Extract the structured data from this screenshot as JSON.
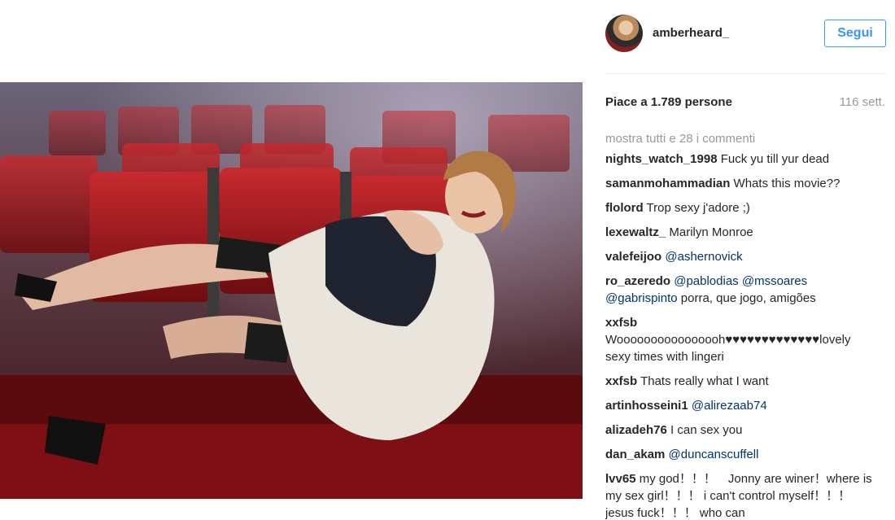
{
  "post": {
    "image_alt": "Foto: donna in lingerie su poltrone rosse di un cinema"
  },
  "header": {
    "username": "amberheard_",
    "follow_label": "Segui"
  },
  "meta": {
    "likes": "Piace a 1.789 persone",
    "age": "116 sett."
  },
  "comments_section": {
    "show_all": "mostra tutti e 28 i commenti",
    "items": [
      {
        "user": "nights_watch_1998",
        "text": " Fuck yu till yur dead",
        "mentions": []
      },
      {
        "user": "samanmohammadian",
        "text": " Whats this movie??",
        "mentions": []
      },
      {
        "user": "flolord",
        "text": " Trop sexy j'adore ;)",
        "mentions": []
      },
      {
        "user": "lexewaltz_",
        "text": " Marilyn Monroe",
        "mentions": []
      },
      {
        "user": "valefeijoo",
        "text": "",
        "mentions": [
          "@ashernovick"
        ]
      },
      {
        "user": "ro_azeredo",
        "text": " porra, que jogo, amigões",
        "mentions": [
          "@pablodias",
          "@mssoares",
          "@gabrispinto"
        ]
      },
      {
        "user": "xxfsb",
        "text": " Woooooooooooooooh♥♥♥♥♥♥♥♥♥♥♥♥♥lovely sexy times with lingeri",
        "mentions": []
      },
      {
        "user": "xxfsb",
        "text": " Thats really what I want",
        "mentions": []
      },
      {
        "user": "artinhosseini1",
        "text": "",
        "mentions": [
          "@alirezaab74"
        ]
      },
      {
        "user": "alizadeh76",
        "text": " I can sex you",
        "mentions": []
      },
      {
        "user": "dan_akam",
        "text": "",
        "mentions": [
          "@duncanscuffell"
        ]
      },
      {
        "user": "lvv65",
        "text": " my god！！！　Jonny are winer！where is my sex girl！！！ i can't control myself！！！ jesus fuck！！！ who can",
        "mentions": []
      }
    ]
  },
  "colors": {
    "accent": "#3897f0",
    "mention": "#003569",
    "muted": "#999999",
    "seat_red": "#a3161c"
  }
}
